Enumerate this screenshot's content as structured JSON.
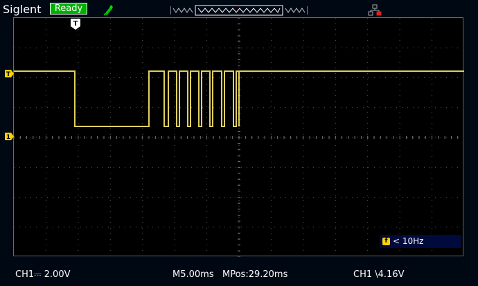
{
  "header": {
    "brand": "Siglent",
    "status": "Ready",
    "icons": [
      "probe-icon",
      "timebase-window-icon",
      "network-icon"
    ]
  },
  "screen": {
    "trigger_marker": "T",
    "level_marker": "T",
    "channel_marker": "1",
    "freq_icon_glyph": "f",
    "freq_text": "< 10Hz"
  },
  "statusbar": {
    "ch1_label": "CH1",
    "ch1_coupling_glyph": "⎓",
    "ch1_scale": "2.00V",
    "timebase": "M5.00ms",
    "mpos": "MPos:29.20ms",
    "trigger_label": "CH1",
    "trigger_edge": "\\",
    "trigger_level": "4.16V"
  },
  "colors": {
    "background": "#000814",
    "trace": "#e0d060",
    "grid": "#5a5a5a",
    "ready_bg": "#00b000",
    "marker": "#ffd200"
  }
}
